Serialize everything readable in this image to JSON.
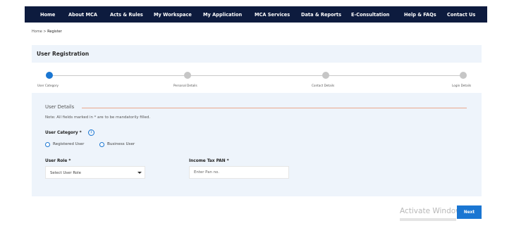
{
  "nav": {
    "items": [
      "Home",
      "About MCA",
      "Acts & Rules",
      "My Workspace",
      "My Application",
      "MCA Services",
      "Data & Reports",
      "E-Consultation",
      "Help & FAQs",
      "Contact Us"
    ]
  },
  "breadcrumb": {
    "home": "Home",
    "separator": ">",
    "current": "Register"
  },
  "registration": {
    "title": "User Registration"
  },
  "stepper": {
    "steps": [
      "User Category",
      "Personal Details",
      "Contact Details",
      "Login Details"
    ],
    "active_index": 0
  },
  "form": {
    "section_title": "User Details",
    "note": "Note: All fields marked in * are to be mandatorily filled.",
    "user_category": {
      "label": "User Category *",
      "info_icon": "info-icon",
      "options": [
        "Registered User",
        "Business User"
      ]
    },
    "user_role": {
      "label": "User Role *",
      "selected": "Select User Role"
    },
    "pan": {
      "label": "Income Tax PAN *",
      "placeholder": "Enter Pan no."
    }
  },
  "actions": {
    "next_label": "Next"
  },
  "watermark": {
    "text": "Activate Windows"
  },
  "colors": {
    "nav_bg": "#0d1b3e",
    "accent": "#1a76d2",
    "panel_bg": "#eef4fb",
    "rule": "#e8a88c"
  }
}
